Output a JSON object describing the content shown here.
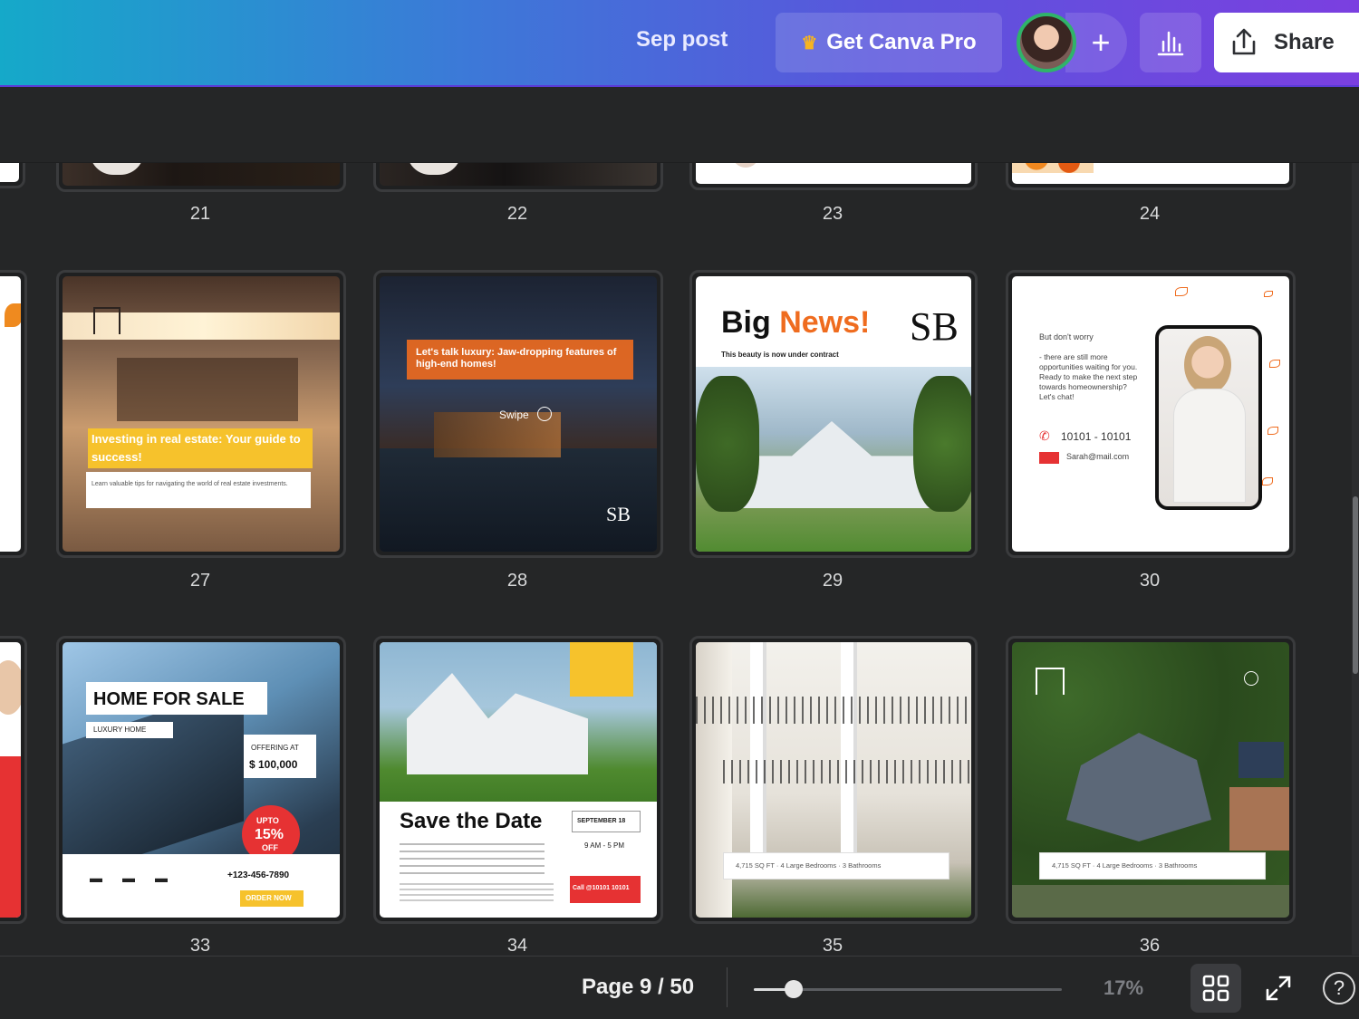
{
  "header": {
    "doc_title": "Sep post",
    "pro_button": "Get Canva Pro",
    "share_button": "Share",
    "add_button": "+"
  },
  "grid": {
    "row1_numbers": [
      "21",
      "22",
      "23",
      "24"
    ],
    "row2_numbers": [
      "27",
      "28",
      "29",
      "30"
    ],
    "row3_numbers": [
      "33",
      "34",
      "35",
      "36"
    ]
  },
  "designs": {
    "p27": {
      "headline": "Investing in real estate: Your guide to success!",
      "body": "Learn valuable tips for navigating the world of real estate investments."
    },
    "p28": {
      "headline": "Let's talk luxury: Jaw-dropping features of high-end homes!",
      "swipe": "Swipe"
    },
    "p29": {
      "title_a": "Big ",
      "title_b": "News!",
      "subtitle": "This beauty is now under contract",
      "logo": "SB"
    },
    "p30": {
      "line1": "But don't worry",
      "line2": "- there are still more opportunities waiting for you. Ready to make the next step towards homeownership? Let's chat!",
      "phone": "10101 - 10101",
      "email": "Sarah@mail.com"
    },
    "p33": {
      "title": "HOME FOR SALE",
      "subtitle": "LUXURY HOME",
      "offer_label": "OFFERING AT",
      "price": "$ 100,000",
      "badge_top": "UPTO",
      "badge_pct": "15%",
      "badge_off": "OFF",
      "phone": "+123-456-7890",
      "cta": "ORDER NOW"
    },
    "p34": {
      "title": "Save the Date",
      "date": "SEPTEMBER 18",
      "time": "9 AM - 5 PM",
      "cta": "Call @10101 10101"
    },
    "p35": {
      "stats": "4,715 SQ FT · 4 Large Bedrooms · 3 Bathrooms"
    },
    "p36": {
      "stats": "4,715 SQ FT · 4 Large Bedrooms · 3 Bathrooms"
    }
  },
  "footer": {
    "page_indicator": "Page 9 / 50",
    "zoom_label": "17%",
    "zoom_fraction": 0.13,
    "help": "?"
  },
  "colors": {
    "accent_orange": "#ef6c1f",
    "accent_yellow": "#f6c22c",
    "badge_red": "#e63233",
    "header_start": "#15a9c9",
    "header_end": "#7b3fe0"
  }
}
